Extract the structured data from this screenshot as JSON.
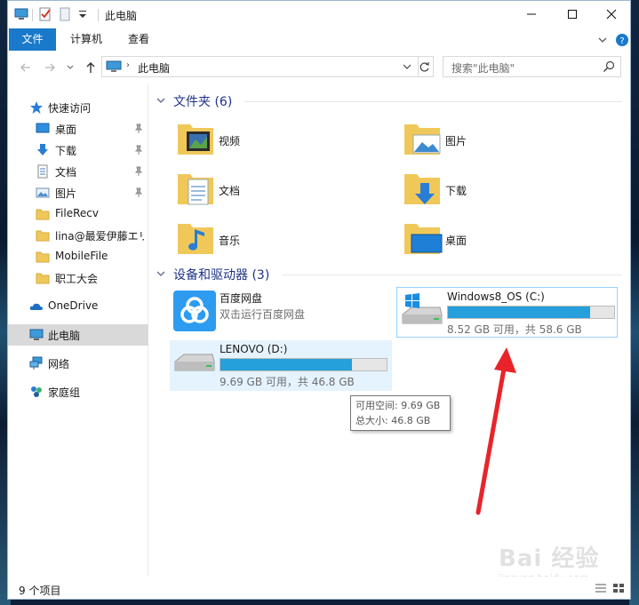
{
  "titlebar": {
    "title": "此电脑",
    "minimize_label": "─",
    "maximize_label": "☐",
    "close_label": "✕"
  },
  "ribbon": {
    "tabs": [
      "文件",
      "计算机",
      "查看"
    ]
  },
  "address": {
    "path": "此电脑",
    "search_placeholder": "搜索\"此电脑\""
  },
  "navpane": {
    "quick_access": "快速访问",
    "quick_items": [
      "桌面",
      "下载",
      "文档",
      "图片",
      "FileRecv",
      "lina@最爱伊藤エリ",
      "MobileFile",
      "职工大会"
    ],
    "onedrive": "OneDrive",
    "this_pc": "此电脑",
    "network": "网络",
    "homegroup": "家庭组"
  },
  "folders_group": {
    "title": "文件夹 (6)",
    "items": [
      "视频",
      "图片",
      "文档",
      "下载",
      "音乐",
      "桌面"
    ]
  },
  "drives_group": {
    "title": "设备和驱动器 (3)",
    "baidu": {
      "name": "百度网盘",
      "subtitle": "双击运行百度网盘"
    },
    "c_drive": {
      "name": "Windows8_OS (C:)",
      "size_text": "8.52 GB 可用，共 58.6 GB",
      "used_fraction": 0.855
    },
    "d_drive": {
      "name": "LENOVO (D:)",
      "size_text": "9.69 GB 可用，共 46.8 GB",
      "used_fraction": 0.793
    }
  },
  "tooltip": {
    "line1": "可用空间: 9.69 GB",
    "line2": "总大小: 46.8 GB"
  },
  "statusbar": {
    "text": "9 个项目"
  },
  "watermark": {
    "logo": "Bai 经验",
    "url": "jingyan.baidu.com"
  },
  "colors": {
    "accent": "#1979ca",
    "drive_bar": "#26a0da",
    "folder": "#f0c85a",
    "annotation_arrow": "#e8242a"
  }
}
